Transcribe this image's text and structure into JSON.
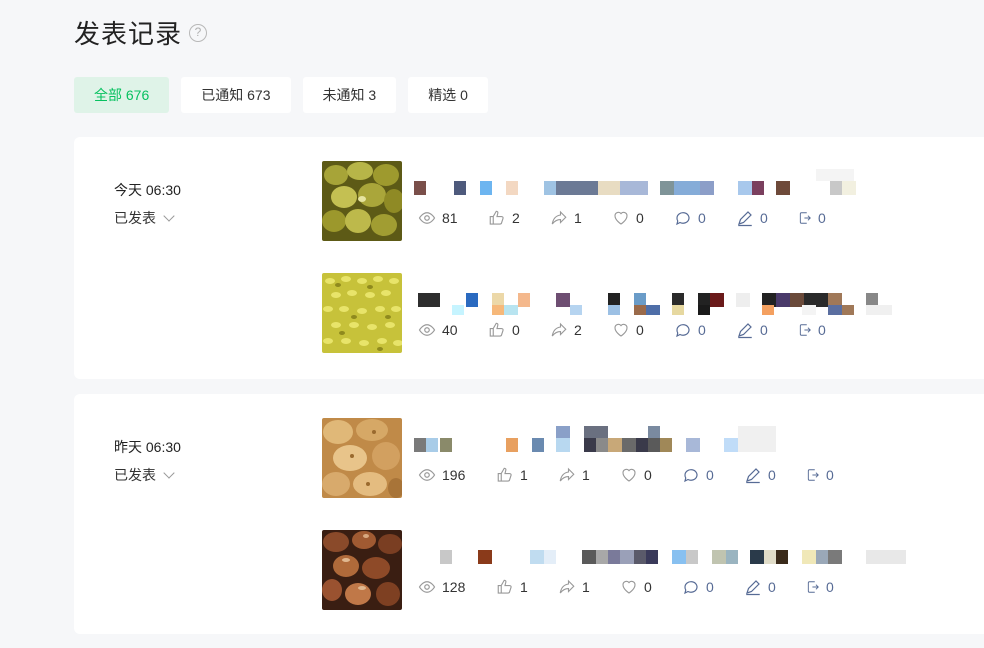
{
  "header": {
    "title": "发表记录",
    "help_glyph": "?"
  },
  "tabs": [
    {
      "label": "全部 676",
      "active": true
    },
    {
      "label": "已通知 673",
      "active": false
    },
    {
      "label": "未通知 3",
      "active": false
    },
    {
      "label": "精选 0",
      "active": false
    }
  ],
  "groups": [
    {
      "date": "今天 06:30",
      "status": "已发表",
      "posts": [
        {
          "thumb": "green-olives-image",
          "stats": {
            "views": "81",
            "likes": "2",
            "shares": "1",
            "favorites": "0",
            "comments": "0",
            "edits": "0",
            "forwards": "0"
          }
        },
        {
          "thumb": "yellow-sprouts-image",
          "stats": {
            "views": "40",
            "likes": "0",
            "shares": "2",
            "favorites": "0",
            "comments": "0",
            "edits": "0",
            "forwards": "0"
          }
        }
      ]
    },
    {
      "date": "昨天 06:30",
      "status": "已发表",
      "posts": [
        {
          "thumb": "fried-food-image",
          "stats": {
            "views": "196",
            "likes": "1",
            "shares": "1",
            "favorites": "0",
            "comments": "0",
            "edits": "0",
            "forwards": "0"
          }
        },
        {
          "thumb": "chestnuts-image",
          "stats": {
            "views": "128",
            "likes": "1",
            "shares": "1",
            "favorites": "0",
            "comments": "0",
            "edits": "0",
            "forwards": "0"
          }
        }
      ]
    }
  ],
  "colors": {
    "accent": "#07c160",
    "accent_bg": "#dff3e8",
    "link_blue": "#576b95"
  }
}
